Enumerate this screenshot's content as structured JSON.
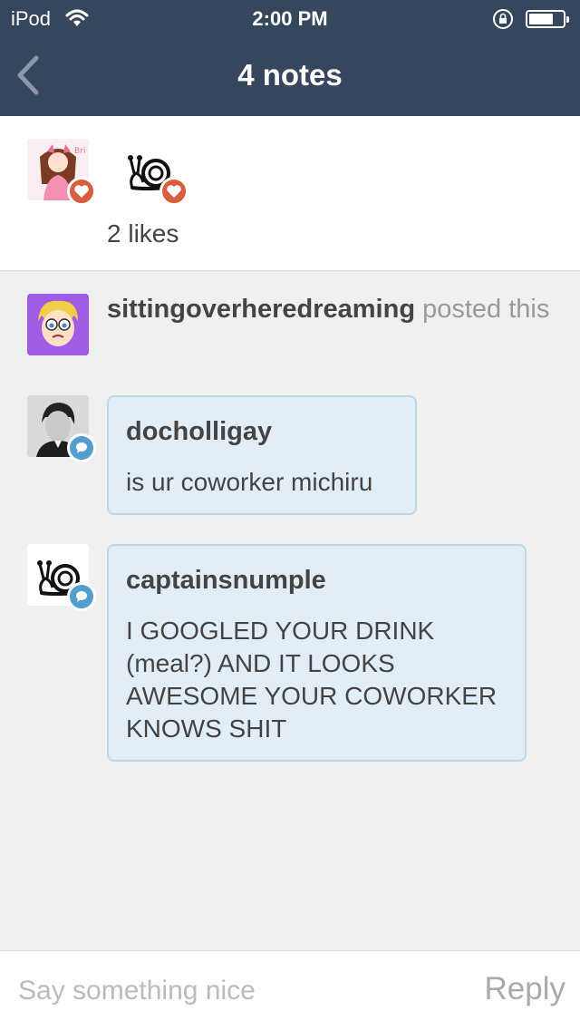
{
  "status_bar": {
    "carrier": "iPod",
    "time": "2:00 PM"
  },
  "nav": {
    "title": "4 notes"
  },
  "likes": {
    "users": [
      {
        "avatar": "anime-girl-avatar"
      },
      {
        "avatar": "snail-avatar"
      }
    ],
    "count_label": "2 likes"
  },
  "poster": {
    "username": "sittingoverheredreaming",
    "action": "posted this"
  },
  "replies": [
    {
      "username": "docholligay",
      "message": "is ur coworker michiru",
      "avatar": "portrait-photo-avatar"
    },
    {
      "username": "captainsnumple",
      "message": "I GOOGLED YOUR DRINK (meal?) AND IT LOOKS AWESOME YOUR COWORKER KNOWS SHIT",
      "avatar": "snail-avatar"
    }
  ],
  "reply_bar": {
    "placeholder": "Say something nice",
    "button_label": "Reply"
  },
  "colors": {
    "nav": "#36465d",
    "heart_badge": "#d95e40",
    "reply_badge": "#529ecc",
    "bubble_bg": "#e2eef7",
    "bubble_border": "#bcd7ea"
  }
}
